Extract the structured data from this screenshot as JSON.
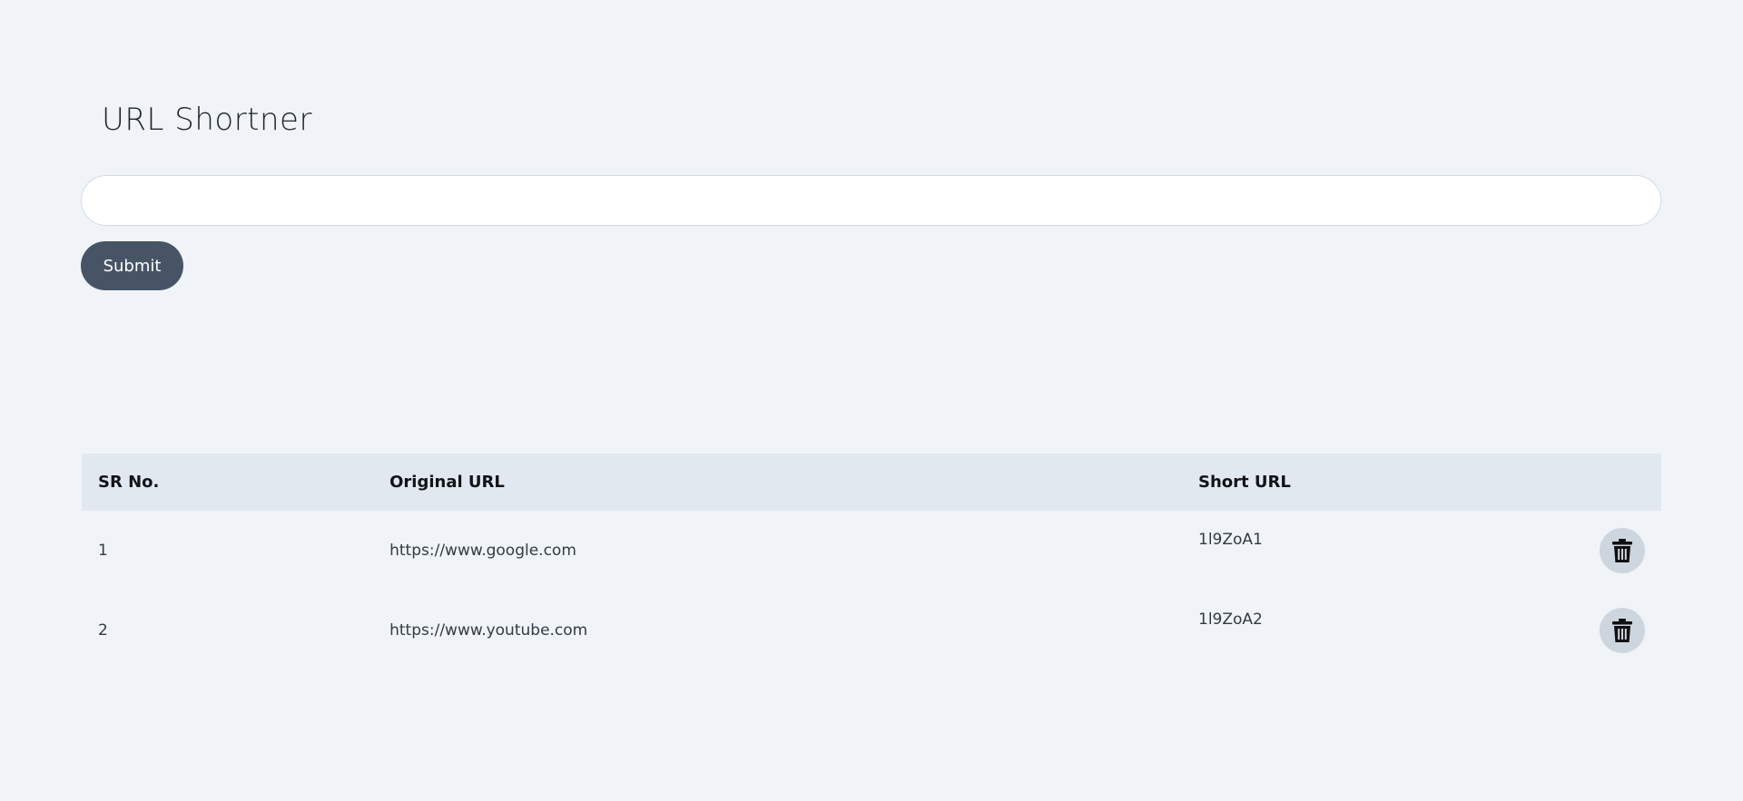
{
  "header": {
    "title": "URL Shortner"
  },
  "form": {
    "input_value": "",
    "input_placeholder": "",
    "submit_label": "Submit"
  },
  "table": {
    "columns": {
      "sr": "SR No.",
      "original": "Original URL",
      "short": "Short URL"
    },
    "rows": [
      {
        "sr": "1",
        "original": "https://www.google.com",
        "short": "1l9ZoA1"
      },
      {
        "sr": "2",
        "original": "https://www.youtube.com",
        "short": "1l9ZoA2"
      }
    ]
  },
  "icons": {
    "delete": "trash-icon"
  },
  "colors": {
    "background": "#f0f4f9",
    "button": "#475466",
    "table_header": "#e1e8f0",
    "delete_button": "#cdd5df"
  }
}
